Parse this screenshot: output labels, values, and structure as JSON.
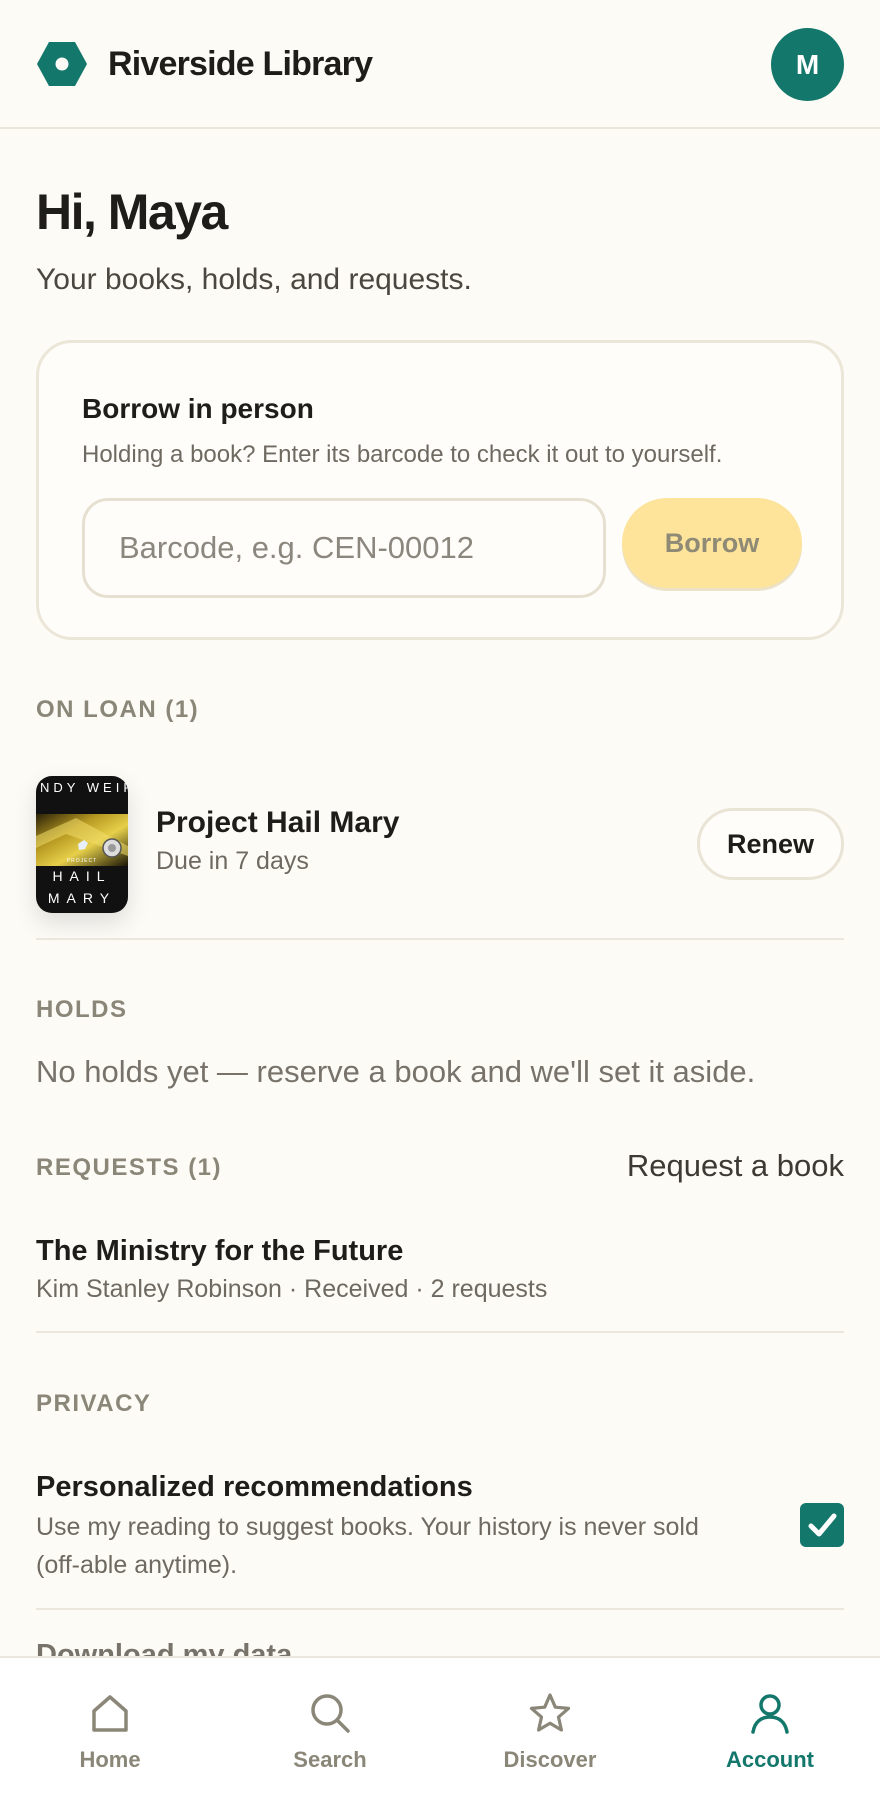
{
  "header": {
    "app_name": "Riverside Library",
    "avatar_initial": "M",
    "brand_color": "#13776b"
  },
  "greeting": {
    "title": "Hi, Maya",
    "subtitle": "Your books, holds, and requests."
  },
  "borrow": {
    "title": "Borrow in person",
    "description": "Holding a book? Enter its barcode to check it out to yourself.",
    "input_placeholder": "Barcode, e.g. CEN-00012",
    "input_value": "",
    "button_label": "Borrow"
  },
  "loans": {
    "label": "ON LOAN (1)",
    "items": [
      {
        "title": "Project Hail Mary",
        "due": "Due in 7 days",
        "action": "Renew",
        "cover_author": "ANDY WEIR",
        "cover_kicker": "PROJECT",
        "cover_title_1": "HAIL",
        "cover_title_2": "MARY"
      }
    ]
  },
  "holds": {
    "label": "HOLDS",
    "empty_text": "No holds yet — reserve a book and we'll set it aside."
  },
  "requests": {
    "label": "REQUESTS (1)",
    "link_label": "Request a book",
    "items": [
      {
        "title": "The Ministry for the Future",
        "meta": "Kim Stanley Robinson · Received · 2 requests"
      }
    ]
  },
  "privacy": {
    "label": "PRIVACY",
    "items": [
      {
        "title": "Personalized recommendations",
        "description": "Use my reading to suggest books. Your history is never sold (off-able anytime).",
        "checked": true
      }
    ],
    "peek_item": "Download my data"
  },
  "nav": {
    "items": [
      {
        "label": "Home",
        "icon": "home-icon",
        "active": false
      },
      {
        "label": "Search",
        "icon": "search-icon",
        "active": false
      },
      {
        "label": "Discover",
        "icon": "star-icon",
        "active": false
      },
      {
        "label": "Account",
        "icon": "person-icon",
        "active": true
      }
    ]
  }
}
